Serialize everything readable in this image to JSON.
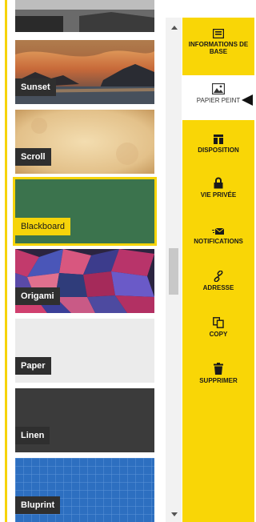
{
  "wallpapers": [
    {
      "label": "",
      "kind": "top-partial"
    },
    {
      "label": "Sunset",
      "kind": "sunset"
    },
    {
      "label": "Scroll",
      "kind": "scroll"
    },
    {
      "label": "Blackboard",
      "kind": "blackboard",
      "selected": true
    },
    {
      "label": "Origami",
      "kind": "origami"
    },
    {
      "label": "Paper",
      "kind": "paper"
    },
    {
      "label": "Linen",
      "kind": "linen"
    },
    {
      "label": "Bluprint",
      "kind": "blueprint"
    }
  ],
  "sidebar": {
    "items": [
      {
        "label": "INFORMATIONS DE BASE",
        "icon": "info-card-icon"
      },
      {
        "label": "PAPIER PEINT",
        "icon": "image-icon",
        "active": true
      },
      {
        "label": "DISPOSITION",
        "icon": "layout-icon"
      },
      {
        "label": "VIE PRIVÉE",
        "icon": "lock-icon"
      },
      {
        "label": "NOTIFICATIONS",
        "icon": "envelope-icon"
      },
      {
        "label": "ADRESSE",
        "icon": "link-icon"
      },
      {
        "label": "COPY",
        "icon": "copy-icon"
      },
      {
        "label": "SUPPRIMER",
        "icon": "trash-icon"
      }
    ]
  },
  "colors": {
    "accent": "#f9d606",
    "label_bg": "#2f2f2f"
  }
}
